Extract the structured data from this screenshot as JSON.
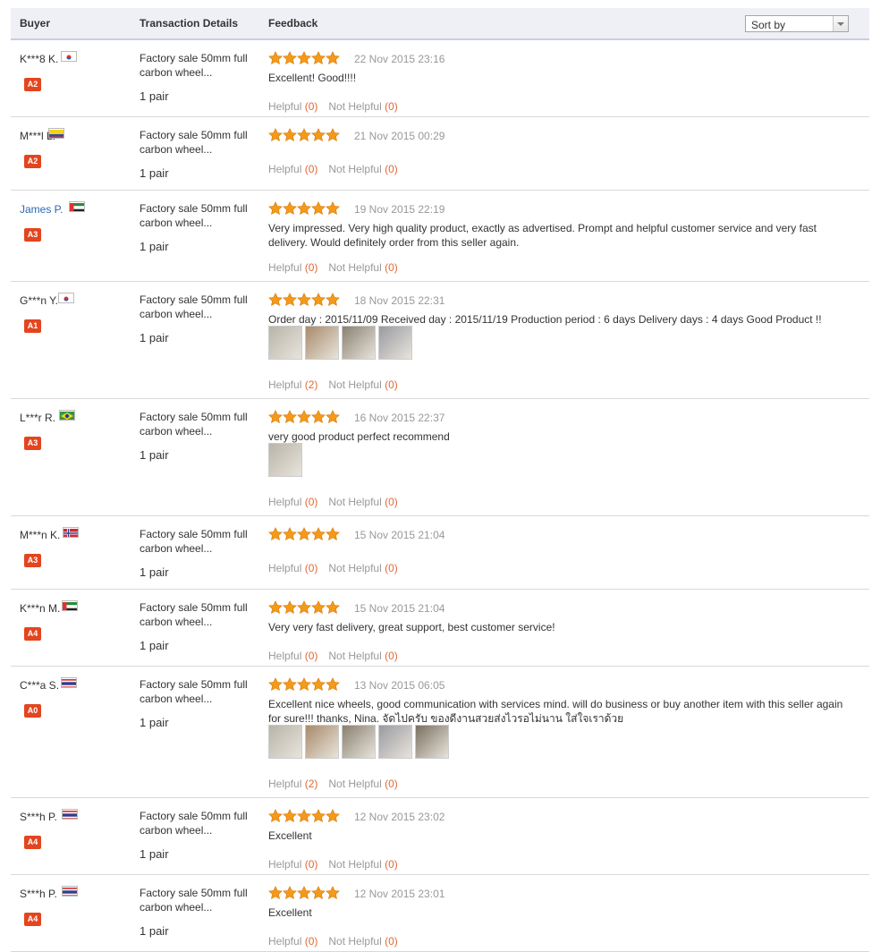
{
  "header": {
    "buyer": "Buyer",
    "details": "Transaction Details",
    "feedback": "Feedback",
    "sort_label": "Sort by"
  },
  "helpful_label": "Helpful",
  "not_helpful_label": "Not Helpful",
  "reviews": [
    {
      "buyer": "K***8 K.",
      "flag": "kr",
      "level": "A2",
      "product": "Factory sale 50mm full carbon wheel...",
      "qty": "1 pair",
      "rating": 5,
      "date": "22 Nov 2015 23:16",
      "text": "Excellent! Good!!!!",
      "helpful": "(0)",
      "not_helpful": "(0)"
    },
    {
      "buyer": "M***l L.",
      "flag": "co",
      "level": "A2",
      "product": "Factory sale 50mm full carbon wheel...",
      "qty": "1 pair",
      "rating": 5,
      "date": "21 Nov 2015 00:29",
      "text": "",
      "helpful": "(0)",
      "not_helpful": "(0)"
    },
    {
      "buyer": "James P.",
      "flag": "ae",
      "level": "A3",
      "product": "Factory sale 50mm full carbon wheel...",
      "qty": "1 pair",
      "rating": 5,
      "date": "19 Nov 2015 22:19",
      "text": "Very impressed. Very high quality product, exactly as advertised. Prompt and helpful customer service and very fast delivery. Would definitely order from this seller again.",
      "helpful": "(0)",
      "not_helpful": "(0)"
    },
    {
      "buyer": "G***n Y.",
      "flag": "kr",
      "level": "A1",
      "product": "Factory sale 50mm full carbon wheel...",
      "qty": "1 pair",
      "rating": 5,
      "date": "18 Nov 2015 22:31",
      "text": "Order day : 2015/11/09 Received day : 2015/11/19 Production period : 6 days Delivery days : 4 days Good Product !!",
      "photos": 4,
      "helpful": "(2)",
      "not_helpful": "(0)"
    },
    {
      "buyer": "L***r R.",
      "flag": "br",
      "level": "A3",
      "product": "Factory sale 50mm full carbon wheel...",
      "qty": "1 pair",
      "rating": 5,
      "date": "16 Nov 2015 22:37",
      "text": "very good product perfect recommend",
      "photos": 1,
      "helpful": "(0)",
      "not_helpful": "(0)"
    },
    {
      "buyer": "M***n K.",
      "flag": "no",
      "level": "A3",
      "product": "Factory sale 50mm full carbon wheel...",
      "qty": "1 pair",
      "rating": 5,
      "date": "15 Nov 2015 21:04",
      "text": "",
      "helpful": "(0)",
      "not_helpful": "(0)"
    },
    {
      "buyer": "K***n M.",
      "flag": "ae",
      "level": "A4",
      "product": "Factory sale 50mm full carbon wheel...",
      "qty": "1 pair",
      "rating": 5,
      "date": "15 Nov 2015 21:04",
      "text": "Very very fast delivery, great support, best customer service!",
      "helpful": "(0)",
      "not_helpful": "(0)"
    },
    {
      "buyer": "C***a S.",
      "flag": "th",
      "level": "A0",
      "product": "Factory sale 50mm full carbon wheel...",
      "qty": "1 pair",
      "rating": 5,
      "date": "13 Nov 2015 06:05",
      "text": "Excellent nice wheels, good communication with services mind. will do business or buy another item with this seller again for sure!!! thanks, Nina. จัดไปครับ ของดีงานสวยส่งไวรอไม่นาน ใส่ใจเราด้วย",
      "photos": 5,
      "helpful": "(2)",
      "not_helpful": "(0)"
    },
    {
      "buyer": "S***h P.",
      "flag": "th",
      "level": "A4",
      "product": "Factory sale 50mm full carbon wheel...",
      "qty": "1 pair",
      "rating": 5,
      "date": "12 Nov 2015 23:02",
      "text": "Excellent",
      "helpful": "(0)",
      "not_helpful": "(0)"
    },
    {
      "buyer": "S***h P.",
      "flag": "th",
      "level": "A4",
      "product": "Factory sale 50mm full carbon wheel...",
      "qty": "1 pair",
      "rating": 5,
      "date": "12 Nov 2015 23:01",
      "text": "Excellent",
      "helpful": "(0)",
      "not_helpful": "(0)"
    }
  ]
}
